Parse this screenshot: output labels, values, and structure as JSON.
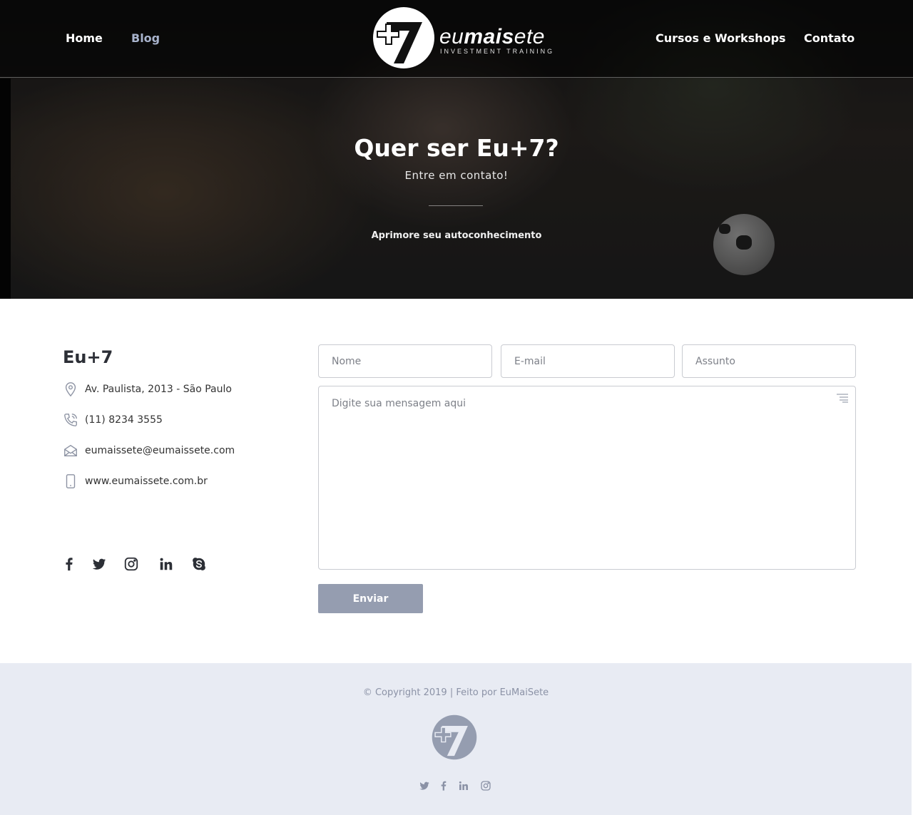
{
  "nav": {
    "home": "Home",
    "blog": "Blog",
    "cursos": "Cursos e Workshops",
    "contato": "Contato"
  },
  "logo": {
    "word_light_1": "eu",
    "word_bold": "mais",
    "word_light_2": "ete",
    "tagline": "INVESTMENT TRAINING"
  },
  "hero": {
    "title": "Quer ser Eu+7?",
    "subtitle": "Entre em contato!",
    "tagline": "Aprimore seu autoconhecimento"
  },
  "contact": {
    "company": "Eu+7",
    "address": "Av. Paulista, 2013 - São Paulo",
    "phone": "(11) 8234 3555",
    "email": "eumaissete@eumaissete.com",
    "website": "www.eumaissete.com.br",
    "icons": [
      "location-pin-icon",
      "phone-icon",
      "envelope-icon",
      "mobile-icon"
    ]
  },
  "social_icons": [
    "facebook-icon",
    "twitter-icon",
    "instagram-icon",
    "linkedin-icon",
    "skype-icon"
  ],
  "form": {
    "nome_placeholder": "Nome",
    "email_placeholder": "E-mail",
    "assunto_placeholder": "Assunto",
    "message_placeholder": "Digite sua mensagem aqui",
    "submit_label": "Enviar"
  },
  "footer": {
    "copyright": "© Copyright 2019 | Feito por EuMaiSete",
    "social_icons": [
      "twitter-icon",
      "facebook-icon",
      "linkedin-icon",
      "instagram-icon"
    ]
  },
  "colors": {
    "accent": "#959db0",
    "nav_active": "#a8b3cc",
    "footer_bg": "#e8ebf3",
    "footer_text": "#8b92a6",
    "text_dark": "#2c2f36"
  }
}
